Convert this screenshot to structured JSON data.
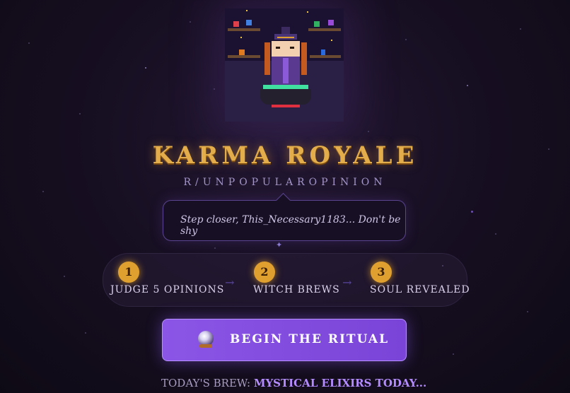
{
  "game": {
    "title": "KARMA ROYALE",
    "subtitle": "R/UNPOPULAROPINION",
    "speech": "Step closer, This_Necessary1183... Don't be shy"
  },
  "steps": [
    {
      "number": "1",
      "label": "JUDGE 5 OPINIONS"
    },
    {
      "number": "2",
      "label": "WITCH BREWS"
    },
    {
      "number": "3",
      "label": "SOUL REVEALED"
    }
  ],
  "arrows": [
    "→",
    "→"
  ],
  "cta": {
    "label": "BEGIN THE RITUAL",
    "icon": "crystal-ball-icon"
  },
  "brew": {
    "prefix": "TODAY'S BREW:",
    "value": "MYSTICAL ELIXIRS TODAY..."
  },
  "colors": {
    "background": "#170f22",
    "title_gold": "#e2ad4a",
    "accent_purple": "#8b55e6",
    "step_badge": "#e0a030",
    "brew_highlight": "#b48cff"
  }
}
